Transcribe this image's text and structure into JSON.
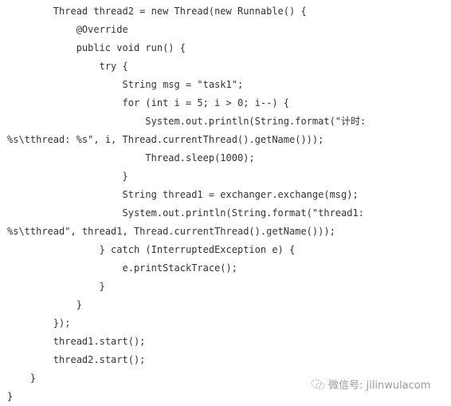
{
  "code": {
    "language": "java",
    "lines": [
      "        Thread thread2 = new Thread(new Runnable() {",
      "            @Override",
      "            public void run() {",
      "                try {",
      "                    String msg = \"task1\";",
      "                    for (int i = 5; i > 0; i--) {",
      "                        System.out.println(String.format(\"计时:",
      "%s\\tthread: %s\", i, Thread.currentThread().getName()));",
      "                        Thread.sleep(1000);",
      "                    }",
      "                    String thread1 = exchanger.exchange(msg);",
      "                    System.out.println(String.format(\"thread1:",
      "%s\\tthread\", thread1, Thread.currentThread().getName()));",
      "                } catch (InterruptedException e) {",
      "                    e.printStackTrace();",
      "                }",
      "            }",
      "        });",
      "        thread1.start();",
      "        thread2.start();",
      "    }",
      "}"
    ]
  },
  "watermark": {
    "icon": "wechat-icon",
    "text": "微信号: jilinwulacom"
  },
  "colors": {
    "text": "#333333",
    "watermark": "#9a9a9a",
    "background": "#ffffff"
  }
}
